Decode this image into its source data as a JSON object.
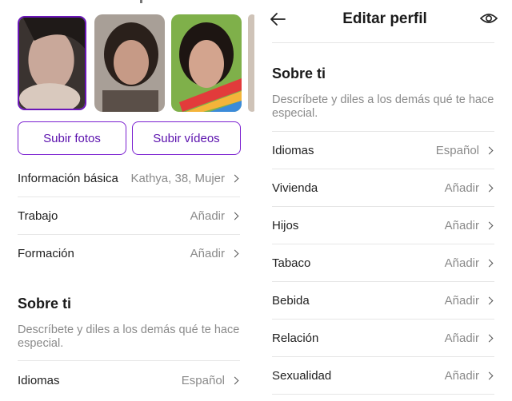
{
  "left": {
    "upload_photos": "Subir fotos",
    "upload_videos": "Subir vídeos",
    "rows": [
      {
        "label": "Información básica",
        "value": "Kathya, 38, Mujer"
      },
      {
        "label": "Trabajo",
        "value": "Añadir"
      },
      {
        "label": "Formación",
        "value": "Añadir"
      }
    ],
    "about_title": "Sobre ti",
    "about_desc": "Descríbete y diles a los demás qué te hace especial.",
    "languages_label": "Idiomas",
    "languages_value": "Español"
  },
  "right": {
    "title": "Editar perfil",
    "about_title": "Sobre ti",
    "about_desc": "Descríbete y diles a los demás qué te hace especial.",
    "rows": [
      {
        "label": "Idiomas",
        "value": "Español"
      },
      {
        "label": "Vivienda",
        "value": "Añadir"
      },
      {
        "label": "Hijos",
        "value": "Añadir"
      },
      {
        "label": "Tabaco",
        "value": "Añadir"
      },
      {
        "label": "Bebida",
        "value": "Añadir"
      },
      {
        "label": "Relación",
        "value": "Añadir"
      },
      {
        "label": "Sexualidad",
        "value": "Añadir"
      }
    ]
  },
  "colors": {
    "accent": "#6a16b8",
    "muted": "#8a8a8a",
    "divider": "#e6e6e6"
  },
  "icons": {
    "back": "arrow-left-icon",
    "preview": "eye-icon",
    "row_action": "chevron-right-icon"
  }
}
